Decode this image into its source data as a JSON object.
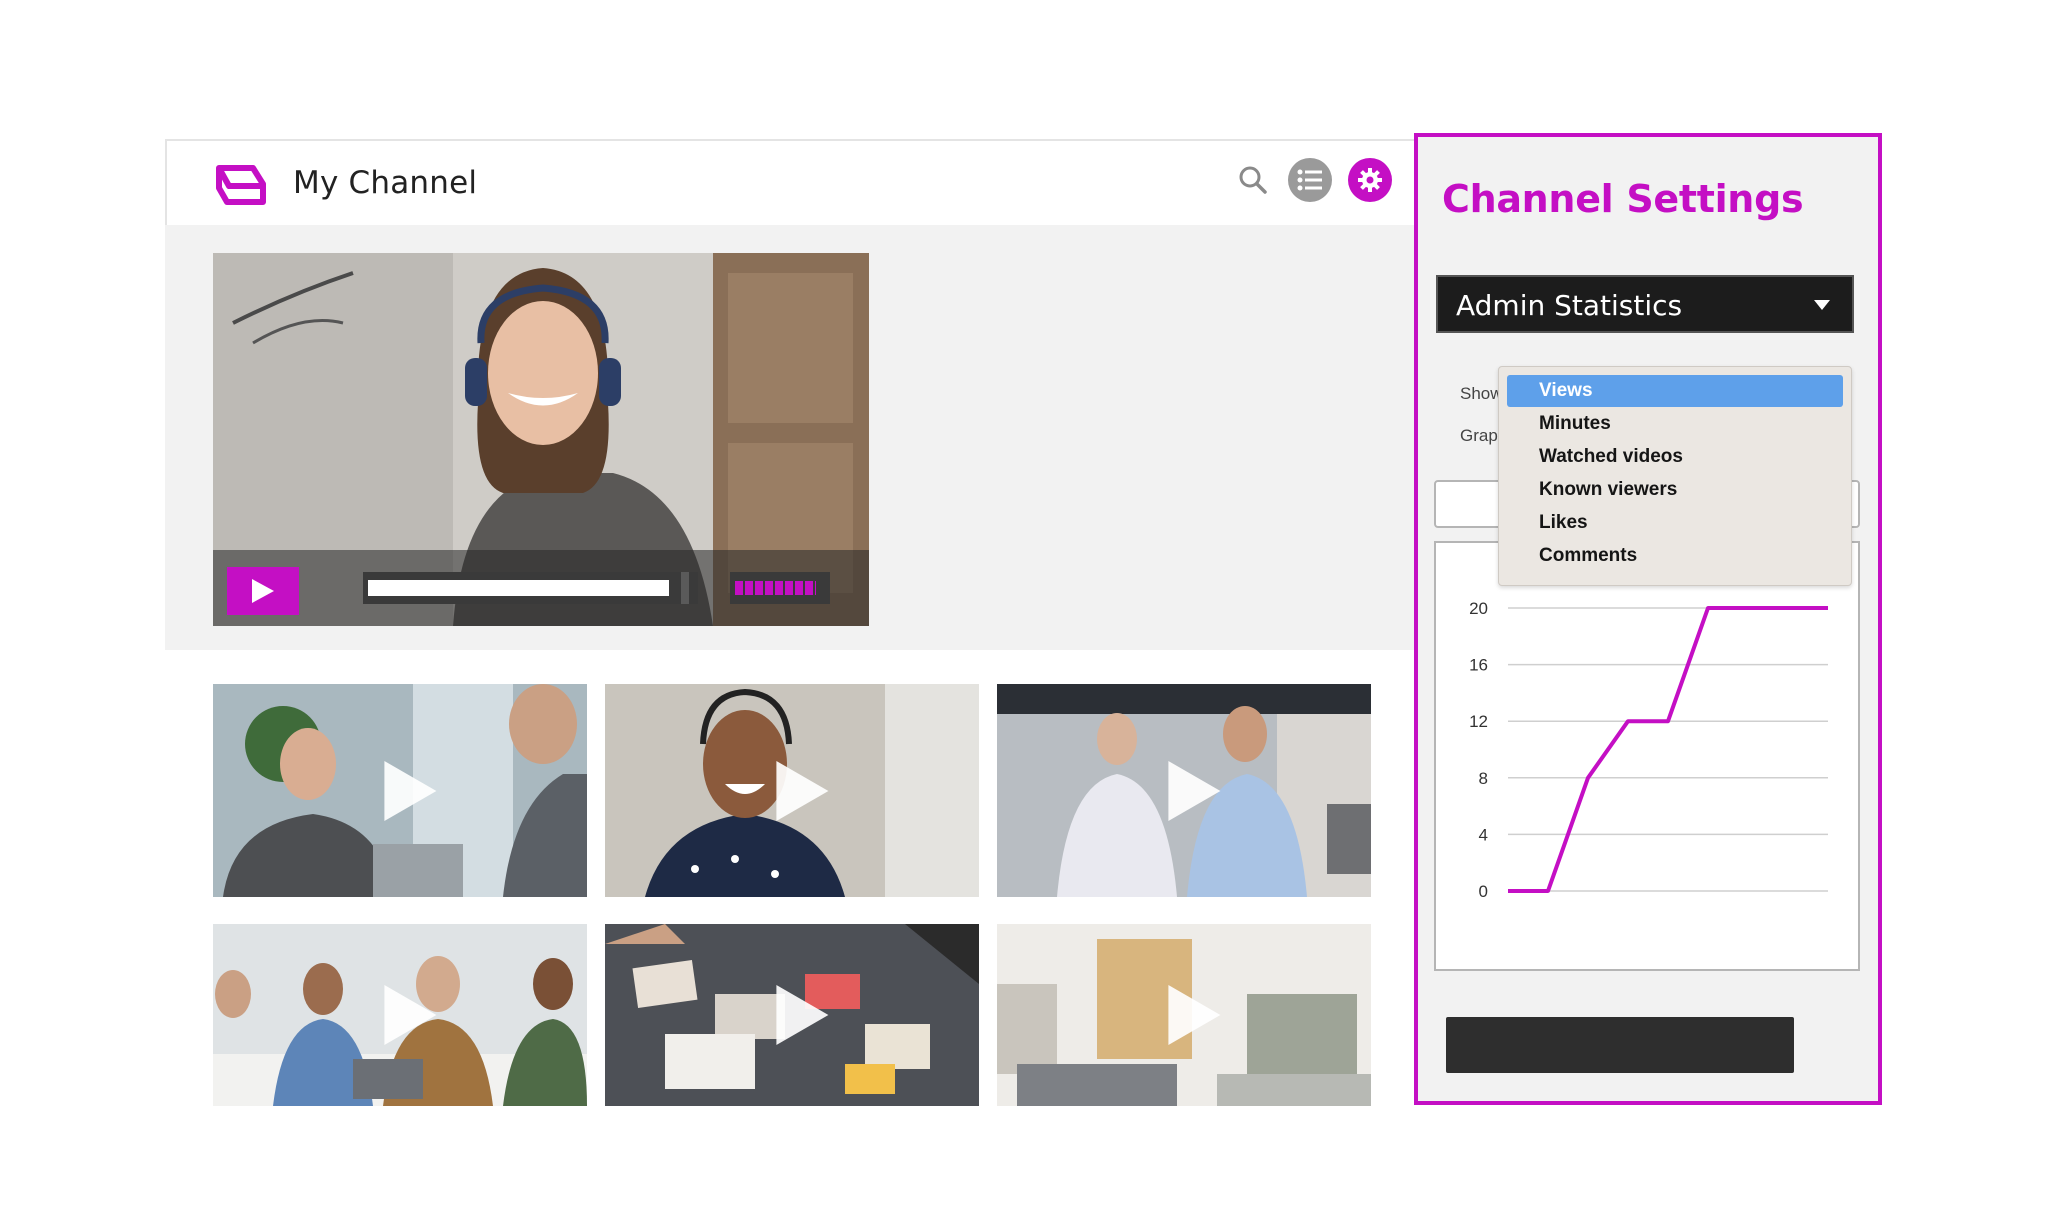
{
  "header": {
    "channel_title": "My Channel",
    "icons": [
      "logo-icon",
      "search-icon",
      "list-icon",
      "gear-icon"
    ]
  },
  "hero_video": {
    "progress": 0.97,
    "volume": 0.9
  },
  "settings": {
    "title": "Channel Settings",
    "statistics_select": "Admin Statistics",
    "show_label": "Show",
    "graph_label": "Graph",
    "dropdown_options": [
      "Views",
      "Minutes",
      "Watched videos",
      "Known viewers",
      "Likes",
      "Comments"
    ],
    "selected_option": "Views"
  },
  "colors": {
    "accent": "#c40fc4",
    "selected_option": "#5ea0ea",
    "dark_control": "#1c1c1c"
  },
  "chart_data": {
    "type": "line",
    "ylim": [
      0,
      20
    ],
    "y_ticks": [
      "20",
      "16",
      "12",
      "8",
      "4",
      "0"
    ],
    "x": [
      0,
      1,
      2,
      3,
      4,
      5,
      6,
      7,
      8
    ],
    "series": [
      {
        "values": [
          0,
          0,
          8,
          12,
          12,
          20,
          20,
          20,
          20
        ]
      }
    ],
    "grid": true,
    "legend": "none"
  }
}
